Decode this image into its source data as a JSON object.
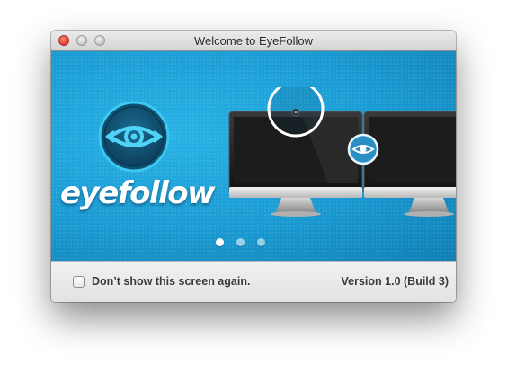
{
  "window": {
    "title": "Welcome to EyeFollow"
  },
  "banner": {
    "brand_name": "eyefollow",
    "logo_icon": "eye-icon",
    "slides": {
      "count": 3,
      "active": 1
    }
  },
  "footer": {
    "checkbox_label": "Don’t show this screen again.",
    "checkbox_checked": false,
    "version": "Version 1.0 (Build 3)"
  },
  "colors": {
    "banner_blue": "#1a9ad2",
    "close_red": "#e0443a"
  }
}
